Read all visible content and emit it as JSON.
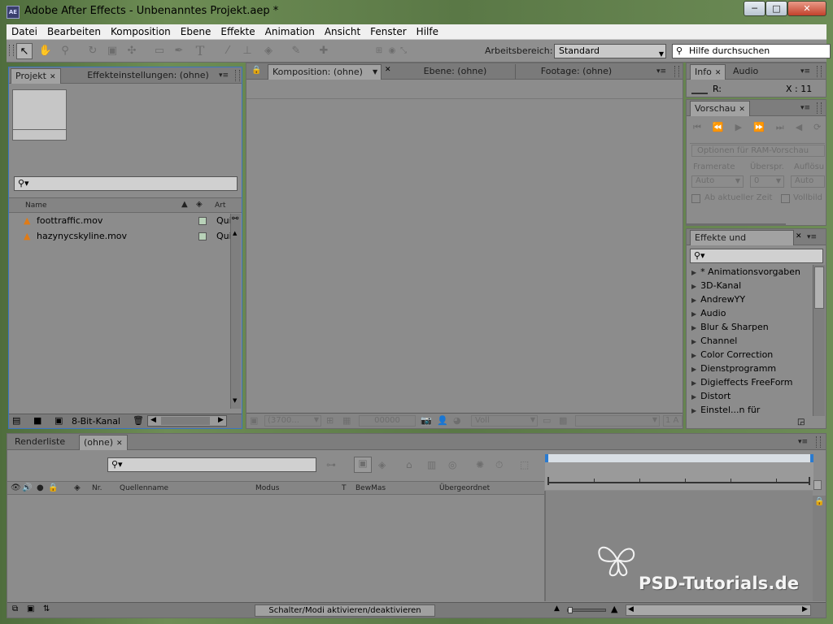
{
  "window": {
    "app_icon_text": "AE",
    "title": "Adobe After Effects - Unbenanntes Projekt.aep *",
    "controls": [
      "─",
      "□",
      "✕"
    ]
  },
  "menu": [
    "Datei",
    "Bearbeiten",
    "Komposition",
    "Ebene",
    "Effekte",
    "Animation",
    "Ansicht",
    "Fenster",
    "Hilfe"
  ],
  "toolbar": {
    "workspace_label": "Arbeitsbereich:",
    "workspace_value": "Standard",
    "help_search": "Hilfe durchsuchen"
  },
  "project_panel": {
    "tabs": [
      "Projekt",
      "Effekteinstellungen: (ohne)"
    ],
    "columns": {
      "name": "Name",
      "type": "Art"
    },
    "items": [
      {
        "name": "foottraffic.mov",
        "type": "Qui"
      },
      {
        "name": "hazynycskyline.mov",
        "type": "Qui"
      }
    ],
    "bit_depth": "8-Bit-Kanal"
  },
  "viewer": {
    "tabs": [
      "Komposition: (ohne)",
      "Ebene: (ohne)",
      "Footage: (ohne)"
    ],
    "zoom": "(3700...",
    "timecode": "00000",
    "resolution": "Voll",
    "views": "1 A"
  },
  "info_panel": {
    "tabs": [
      "Info",
      "Audio"
    ],
    "r_label": "R:",
    "x_label": "X : 11"
  },
  "preview_panel": {
    "tab": "Vorschau",
    "ram_options": "Optionen für RAM-Vorschau",
    "labels": {
      "framerate": "Framerate",
      "skip": "Überspr.",
      "resolution": "Auflösu"
    },
    "values": {
      "framerate": "Auto",
      "skip": "0",
      "resolution": "Auto"
    },
    "checkboxes": {
      "from_current": "Ab aktueller Zeit",
      "fullscreen": "Vollbild"
    }
  },
  "effects_panel": {
    "tab": "Effekte und Vorgaben",
    "items": [
      "* Animationsvorgaben",
      "3D-Kanal",
      "AndrewYY",
      "Audio",
      "Blur & Sharpen",
      "Channel",
      "Color Correction",
      "Dienstprogramm",
      "Digieffects FreeForm",
      "Distort",
      "Einstel...n für Expressions"
    ]
  },
  "timeline_panel": {
    "tabs": [
      "Renderliste",
      "(ohne)"
    ],
    "columns": {
      "nr": "Nr.",
      "source_name": "Quellenname",
      "mode": "Modus",
      "t": "T",
      "trkmat": "BewMas",
      "parent": "Übergeordnet"
    },
    "toggle_button": "Schalter/Modi aktivieren/deaktivieren"
  },
  "watermark": {
    "text": "PSD-Tutorials.de"
  },
  "colors": {
    "panel_bg": "#8c8c8c",
    "timeline_work_area": "#d8dee4",
    "playhead_blue": "#2b7bd0"
  }
}
